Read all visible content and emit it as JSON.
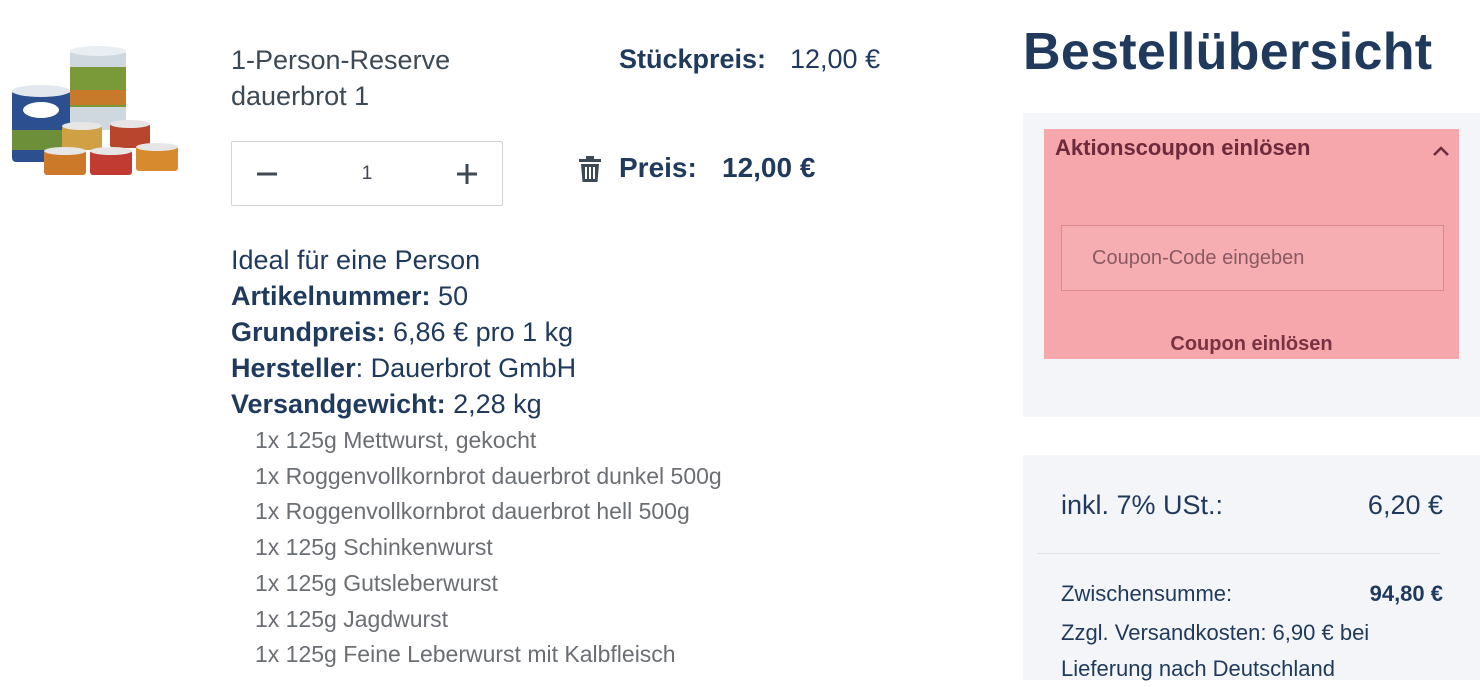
{
  "product": {
    "title": "1-Person-Reserve dauerbrot 1",
    "image_alt": "dauerbrot Dosen-Set",
    "unit_price_label": "Stückpreis:",
    "unit_price_value": "12,00 €",
    "quantity": "1",
    "price_label": "Preis:",
    "price_value": "12,00 €",
    "tagline": "Ideal für eine Person",
    "article_number_label": "Artikelnummer:",
    "article_number_value": " 50",
    "base_price_label": "Grundpreis:",
    "base_price_value": " 6,86 € pro 1 kg",
    "manufacturer_label": "Hersteller",
    "manufacturer_value": ": Dauerbrot GmbH",
    "shipping_weight_label": "Versandgewicht:",
    "shipping_weight_value": " 2,28 kg",
    "contents": [
      "1x 125g Mettwurst, gekocht",
      "1x Roggenvollkornbrot dauerbrot dunkel 500g",
      "1x Roggenvollkornbrot dauerbrot hell 500g",
      "1x 125g Schinkenwurst",
      "1x 125g Gutsleberwurst",
      "1x 125g Jagdwurst",
      "1x 125g Feine Leberwurst mit Kalbfleisch"
    ]
  },
  "summary": {
    "title": "Bestellübersicht",
    "coupon": {
      "header": "Aktionscoupon einlösen",
      "placeholder": "Coupon-Code eingeben",
      "submit_label": "Coupon einlösen"
    },
    "tax_label": "inkl. 7% USt.:",
    "tax_value": "6,20 €",
    "subtotal_label": "Zwischensumme:",
    "subtotal_value": "94,80 €",
    "shipping_note": "Zzgl. Versandkosten: 6,90 € bei Lieferung nach Deutschland"
  },
  "colors": {
    "primary": "#1f3a5c",
    "coupon_highlight": "#f5a7ab",
    "panel_bg": "#f3f5f8"
  },
  "icons": {
    "minus": "minus-icon",
    "plus": "plus-icon",
    "trash": "trash-icon",
    "chevron": "chevron-up-icon"
  }
}
